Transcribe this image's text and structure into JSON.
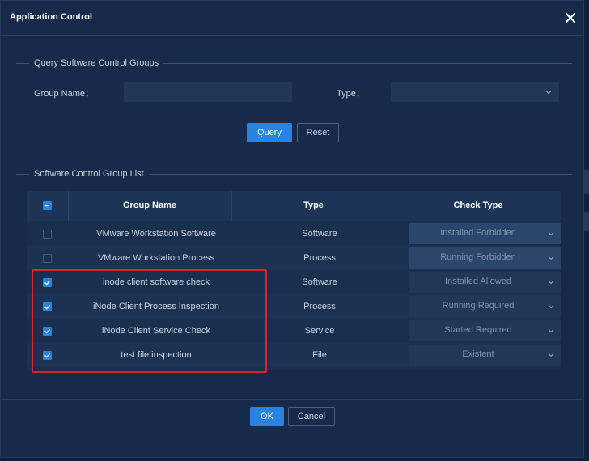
{
  "dialog": {
    "title": "Application Control",
    "close_icon": "close-icon"
  },
  "query": {
    "legend": "Query Software Control Groups",
    "group_name_label": "Group Name：",
    "group_name_value": "",
    "type_label": "Type：",
    "type_value": "",
    "query_button": "Query",
    "reset_button": "Reset"
  },
  "list": {
    "legend": "Software Control Group List",
    "columns": [
      "Group Name",
      "Type",
      "Check Type"
    ],
    "select_all_state": "indeterminate",
    "rows": [
      {
        "checked": false,
        "group_name": "VMware Workstation Software",
        "type": "Software",
        "check_type": "Installed Forbidden",
        "check_type_disabled": true
      },
      {
        "checked": false,
        "group_name": "VMware Workstation Process",
        "type": "Process",
        "check_type": "Running Forbidden",
        "check_type_disabled": true
      },
      {
        "checked": true,
        "group_name": "inode client  software check",
        "type": "Software",
        "check_type": "Installed Allowed",
        "check_type_disabled": false
      },
      {
        "checked": true,
        "group_name": "iNode Client Process Inspection",
        "type": "Process",
        "check_type": "Running Required",
        "check_type_disabled": false
      },
      {
        "checked": true,
        "group_name": "iNode Client Service Check",
        "type": "Service",
        "check_type": "Started Required",
        "check_type_disabled": false
      },
      {
        "checked": true,
        "group_name": "test file inspection",
        "type": "File",
        "check_type": "Existent",
        "check_type_disabled": false
      }
    ]
  },
  "footer": {
    "ok_button": "OK",
    "cancel_button": "Cancel"
  },
  "colors": {
    "accent": "#2784e0",
    "highlight": "#d9262a",
    "background": "#172a49"
  }
}
